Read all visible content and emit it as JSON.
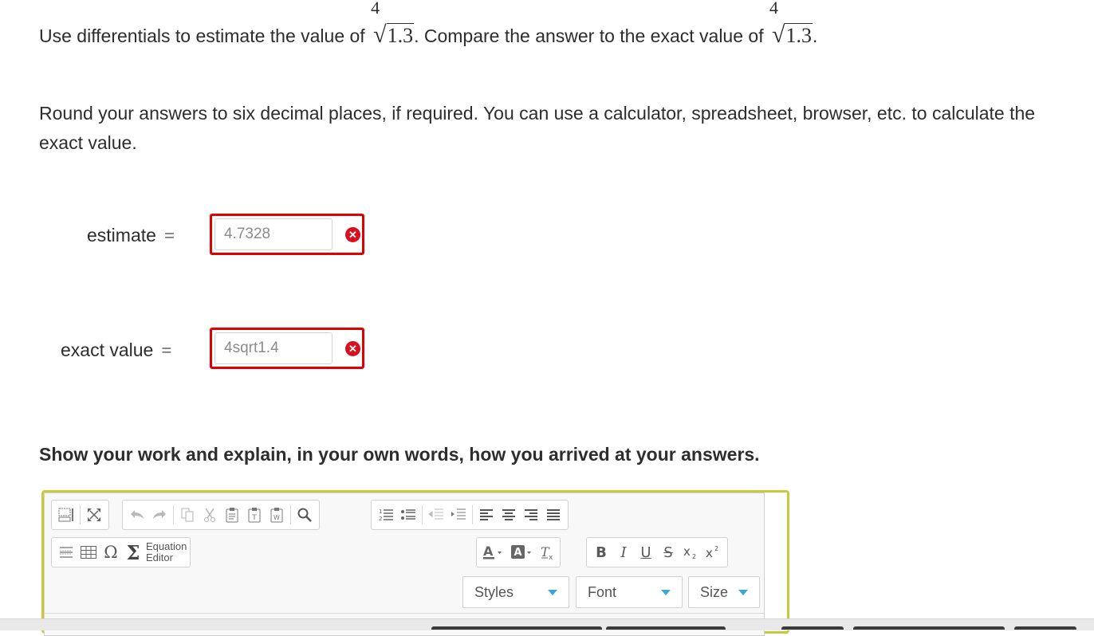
{
  "question": {
    "part1": "Use differentials to estimate the value of",
    "part2": ". Compare the answer to the exact value of",
    "part3": ".",
    "root_index": "4",
    "radicand": "1.3",
    "instructions": "Round your answers to six decimal places, if required. You can use a calculator, spreadsheet, browser, etc. to calculate the exact value."
  },
  "answers": {
    "estimate": {
      "label": "estimate",
      "value": "4.7328",
      "status": "incorrect"
    },
    "exact": {
      "label": "exact value",
      "value": "4sqrt1.4",
      "status": "incorrect"
    },
    "equals": "="
  },
  "work_prompt": "Show your work and explain, in your own words, how you arrived at your answers.",
  "editor": {
    "equation_editor_line1": "Equation",
    "equation_editor_line2": "Editor",
    "styles_label": "Styles",
    "font_label": "Font",
    "size_label": "Size",
    "format_buttons": [
      "B",
      "I",
      "U",
      "S"
    ]
  },
  "colors": {
    "error_border": "#e00000",
    "error_icon": "#d6101e",
    "editor_border": "#c9c93a",
    "combo_arrow": "#39a5d8"
  }
}
